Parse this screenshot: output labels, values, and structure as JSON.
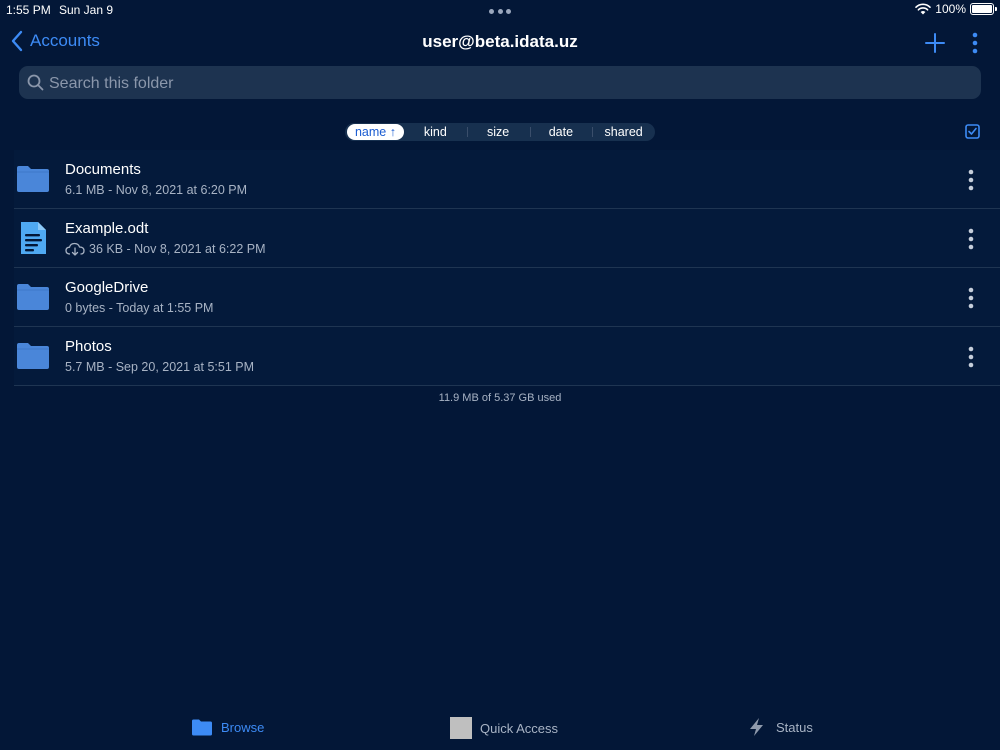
{
  "status": {
    "time": "1:55 PM",
    "date": "Sun Jan 9",
    "battery": "100%"
  },
  "nav": {
    "back_label": "Accounts",
    "title": "user@beta.idata.uz"
  },
  "search": {
    "placeholder": "Search this folder",
    "value": ""
  },
  "sort": {
    "options": [
      "name",
      "kind",
      "size",
      "date",
      "shared"
    ],
    "active": "name",
    "active_arrow": "↑"
  },
  "files": [
    {
      "name": "Documents",
      "meta": "6.1 MB - Nov 8, 2021 at 6:20 PM",
      "icon": "folder-icon",
      "cloud": false
    },
    {
      "name": "Example.odt",
      "meta": "36 KB - Nov 8, 2021 at 6:22 PM",
      "icon": "document-icon",
      "cloud": true
    },
    {
      "name": "GoogleDrive",
      "meta": "0 bytes - Today at 1:55 PM",
      "icon": "folder-icon",
      "cloud": false
    },
    {
      "name": "Photos",
      "meta": "5.7 MB - Sep 20, 2021 at 5:51 PM",
      "icon": "folder-icon",
      "cloud": false
    }
  ],
  "usage": "11.9 MB of 5.37 GB used",
  "tabs": [
    {
      "label": "Browse",
      "icon": "folder-icon",
      "active": true
    },
    {
      "label": "Quick Access",
      "icon": "quick-access-icon",
      "active": false
    },
    {
      "label": "Status",
      "icon": "bolt-icon",
      "active": false
    }
  ],
  "colors": {
    "background": "#031737",
    "accent": "#3d8bf5",
    "folder": "#4a86d9",
    "search_bg": "#1d3350"
  }
}
